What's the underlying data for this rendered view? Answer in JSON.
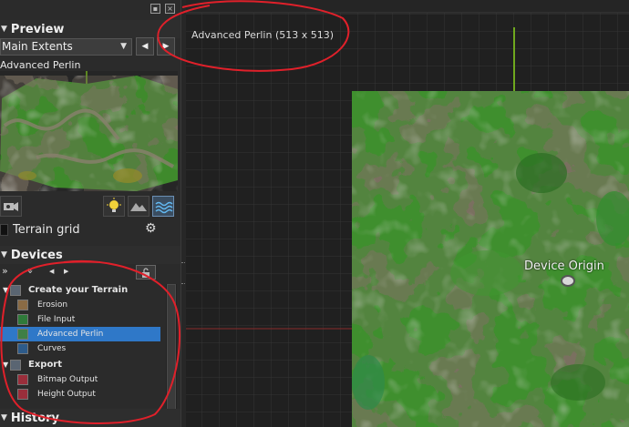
{
  "preview": {
    "header": "Preview",
    "extents_dropdown": "Main Extents",
    "preview_label": "Advanced Perlin",
    "terrain_grid_label": "Terrain grid"
  },
  "devices": {
    "header": "Devices",
    "tree": [
      {
        "label": "Create your Terrain",
        "type": "group"
      },
      {
        "label": "Erosion",
        "type": "item"
      },
      {
        "label": "File Input",
        "type": "item"
      },
      {
        "label": "Advanced Perlin",
        "type": "item",
        "selected": true
      },
      {
        "label": "Curves",
        "type": "item"
      },
      {
        "label": "Export",
        "type": "group"
      },
      {
        "label": "Bitmap Output",
        "type": "item"
      },
      {
        "label": "Height Output",
        "type": "item"
      }
    ]
  },
  "history": {
    "header": "History"
  },
  "viewport": {
    "title": "Advanced Perlin (513 x 513)",
    "origin_label": "Device Origin"
  },
  "icons": {
    "close": "close-icon",
    "pin": "pin-icon",
    "prev": "left-arrow-icon",
    "next": "right-arrow-icon",
    "gear": "gear-icon",
    "lock": "lock-icon"
  },
  "colors": {
    "selection": "#2f78c8",
    "grid_line": "#343434",
    "green_axis": "#6fa81e",
    "red_axis": "#8a2a2a",
    "annotation": "#e0202a"
  }
}
